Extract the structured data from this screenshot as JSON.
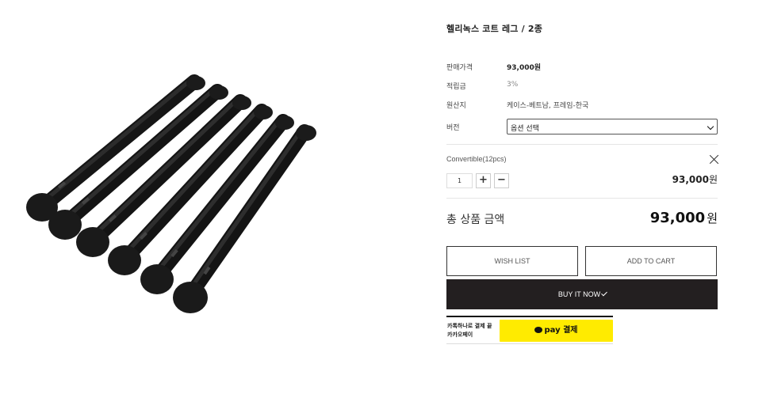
{
  "product": {
    "title": "헬리녹스 코트 레그 / 2종",
    "image_alt": "black folding leg poles"
  },
  "info": {
    "price_label": "판매가격",
    "price_value": "93,000원",
    "points_label": "적립금",
    "points_value": "3%",
    "origin_label": "원산지",
    "origin_value": "케이스-베트남, 프레임-한국",
    "version_label": "버전",
    "version_selected": "옵션 선택"
  },
  "selected_option": {
    "name": "Convertible(12pcs)",
    "quantity": "1",
    "plus": "+",
    "minus": "−",
    "price": "93,000",
    "currency": "원"
  },
  "total": {
    "label": "총 상품 금액",
    "price": "93,000",
    "currency": "원"
  },
  "buttons": {
    "wish": "WISH LIST",
    "cart": "ADD TO CART",
    "buy": "BUY IT NOW"
  },
  "kakao": {
    "line1": "카톡하나로 결제 끝",
    "line2": "카카오페이",
    "pay_label": "pay",
    "pay_suffix": "결제",
    "color": "#ffeb00"
  },
  "colors": {
    "buy_button": "#231f20"
  }
}
